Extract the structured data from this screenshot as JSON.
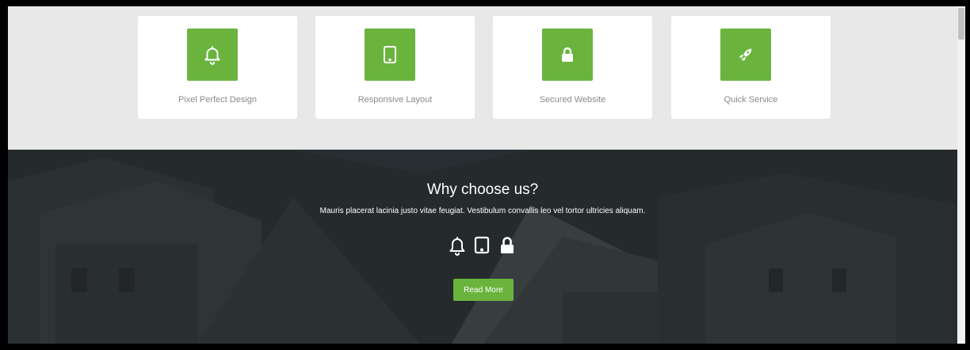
{
  "features": [
    {
      "label": "Pixel Perfect Design",
      "icon": "bell-icon"
    },
    {
      "label": "Responsive Layout",
      "icon": "tablet-icon"
    },
    {
      "label": "Secured Website",
      "icon": "lock-icon"
    },
    {
      "label": "Quick Service",
      "icon": "rocket-icon"
    }
  ],
  "hero": {
    "title": "Why choose us?",
    "subtitle": "Mauris placerat lacinia justo vitae feugiat. Vestibulum convallis leo vel tortor ultricies aliquam.",
    "icons": [
      "bell-icon",
      "tablet-icon",
      "lock-icon"
    ],
    "button_label": "Read More"
  },
  "colors": {
    "accent": "#6ab43e",
    "page_bg": "#e8e8e8",
    "hero_overlay": "#2c3134"
  }
}
